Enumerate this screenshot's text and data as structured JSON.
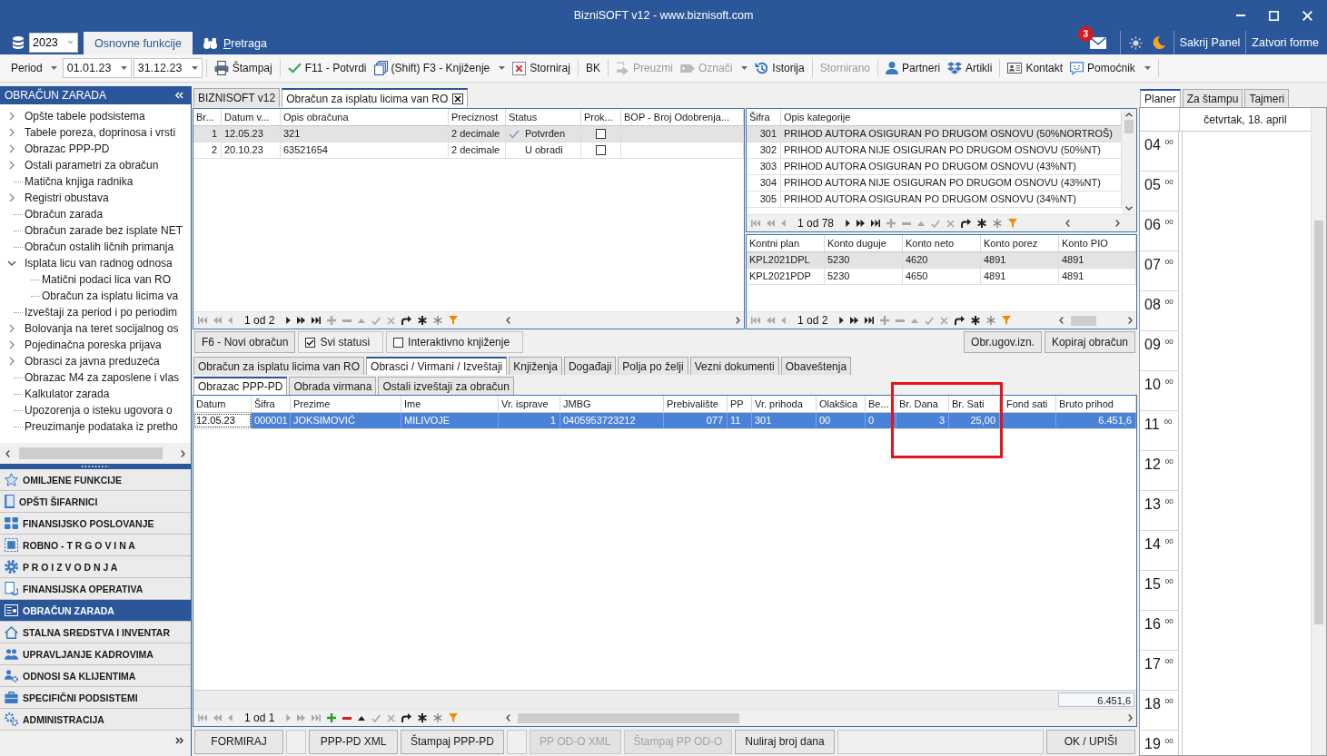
{
  "window": {
    "title": "BizniSOFT v12 - www.biznisoft.com"
  },
  "ribbon": {
    "year": "2023",
    "tabs": [
      {
        "label": "Osnovne funkcije",
        "selected": true,
        "accelerator": false
      },
      {
        "label": "Pretraga",
        "selected": false,
        "accelerator": true
      }
    ],
    "unread": "3",
    "links": [
      "Sakrij Panel",
      "Zatvori forme"
    ]
  },
  "toolbar": {
    "period": {
      "label": "Period",
      "from": "01.01.23",
      "to": "31.12.23"
    },
    "groups": [
      [
        {
          "label": "Štampaj",
          "disabled": false,
          "dropdown": false
        }
      ],
      [
        {
          "label": "F11 - Potvrdi",
          "disabled": false,
          "dropdown": false
        },
        {
          "label": "(Shift) F3 - Knjiženje",
          "disabled": false,
          "dropdown": true
        },
        {
          "label": "Storniraj",
          "disabled": false,
          "dropdown": false
        }
      ],
      [
        {
          "label": "BK",
          "disabled": false,
          "dropdown": false
        }
      ],
      [
        {
          "label": "Preuzmi",
          "disabled": true,
          "dropdown": false
        },
        {
          "label": "Označi",
          "disabled": true,
          "dropdown": true
        },
        {
          "label": "Istorija",
          "disabled": false,
          "dropdown": false
        }
      ],
      [
        {
          "label": "Stornirano",
          "disabled": true,
          "dropdown": false
        }
      ],
      [
        {
          "label": "Partneri",
          "disabled": false,
          "dropdown": false
        },
        {
          "label": "Artikli",
          "disabled": false,
          "dropdown": false
        }
      ],
      [
        {
          "label": "Kontakt",
          "disabled": false,
          "dropdown": false
        },
        {
          "label": "Pomoćnik",
          "disabled": false,
          "dropdown": true
        }
      ]
    ]
  },
  "sidebar": {
    "title": "OBRAČUN ZARADA",
    "tree": [
      {
        "label": "Opšte tabele podsistema",
        "kind": "group",
        "expanded": false
      },
      {
        "label": "Tabele poreza, doprinosa i vrsti",
        "kind": "group",
        "expanded": false
      },
      {
        "label": "Obrazac PPP-PD",
        "kind": "group",
        "expanded": false
      },
      {
        "label": "Ostali parametri za obračun",
        "kind": "group",
        "expanded": false
      },
      {
        "label": "Matična knjiga radnika",
        "kind": "item"
      },
      {
        "label": "Registri obustava",
        "kind": "group",
        "expanded": false
      },
      {
        "label": "Obračun zarada",
        "kind": "item"
      },
      {
        "label": "Obračun zarade bez isplate NET",
        "kind": "item"
      },
      {
        "label": "Obračun ostalih ličnih primanja",
        "kind": "item"
      },
      {
        "label": "Isplata licu van radnog odnosa",
        "kind": "group",
        "expanded": true,
        "children": [
          {
            "label": "Matični podaci lica van RO",
            "kind": "item"
          },
          {
            "label": "Obračun za isplatu licima va",
            "kind": "item"
          }
        ]
      },
      {
        "label": "Izveštaji za period i po periodim",
        "kind": "item"
      },
      {
        "label": "Bolovanja na teret socijalnog os",
        "kind": "group",
        "expanded": false
      },
      {
        "label": "Pojedinačna poreska prijava",
        "kind": "group",
        "expanded": false
      },
      {
        "label": "Obrasci za javna preduzeća",
        "kind": "group",
        "expanded": false
      },
      {
        "label": "Obrazac M4 za zaposlene i vlas",
        "kind": "item"
      },
      {
        "label": "Kalkulator zarada",
        "kind": "item"
      },
      {
        "label": "Upozorenja o isteku ugovora o",
        "kind": "item"
      },
      {
        "label": "Preuzimanje podataka iz pretho",
        "kind": "item"
      }
    ],
    "modules": [
      {
        "label": "OMILJENE FUNKCIJE",
        "selected": false
      },
      {
        "label": "OPŠTI ŠIFARNICI",
        "selected": false
      },
      {
        "label": "FINANSIJSKO POSLOVANJE",
        "selected": false
      },
      {
        "label": "ROBNO - T R G O V I N A",
        "selected": false
      },
      {
        "label": "P R O I Z V O D N J A",
        "selected": false
      },
      {
        "label": "FINANSIJSKA OPERATIVA",
        "selected": false
      },
      {
        "label": "OBRAČUN ZARADA",
        "selected": true
      },
      {
        "label": "STALNA SREDSTVA I INVENTAR",
        "selected": false
      },
      {
        "label": "UPRAVLJANJE KADROVIMA",
        "selected": false
      },
      {
        "label": "ODNOSI SA KLIJENTIMA",
        "selected": false
      },
      {
        "label": "SPECIFIČNI PODSISTEMI",
        "selected": false
      },
      {
        "label": "ADMINISTRACIJA",
        "selected": false
      }
    ]
  },
  "document_tabs": [
    {
      "label": "BIZNISOFT v12",
      "selected": false,
      "closable": false
    },
    {
      "label": "Obračun za isplatu licima van RO",
      "selected": true,
      "closable": true
    }
  ],
  "obracuni": {
    "columns": [
      "Br...",
      "Datum v...",
      "Opis obračuna",
      "Preciznost",
      "Status",
      "Prok...",
      "BOP - Broj Odobrenja..."
    ],
    "rows": [
      {
        "br": "1",
        "datum": "12.05.23",
        "opis": "321",
        "preciznost": "2 decimale",
        "status": "Potvrđen",
        "confirmed": true,
        "prok": false,
        "selected": true
      },
      {
        "br": "2",
        "datum": "20.10.23",
        "opis": "63521654",
        "preciznost": "2 decimale",
        "status": "U obradi",
        "confirmed": false,
        "prok": false,
        "selected": false
      }
    ],
    "navigator": {
      "position": "1 od 2",
      "next_enabled": true,
      "editable": false
    }
  },
  "kategorije": {
    "columns": [
      "Šifra",
      "Opis kategorije"
    ],
    "rows": [
      {
        "sifra": "301",
        "opis": "PRIHOD AUTORA OSIGURAN PO DRUGOM OSNOVU (50%NORTROŠ)",
        "selected": true
      },
      {
        "sifra": "302",
        "opis": "PRIHOD AUTORA NIJE OSIGURAN PO DRUGOM OSNOVU (50%NT)",
        "selected": false
      },
      {
        "sifra": "303",
        "opis": "PRIHOD AUTORA OSIGURAN PO DRUGOM OSNOVU (43%NT)",
        "selected": false
      },
      {
        "sifra": "304",
        "opis": "PRIHOD AUTORA NIJE OSIGURAN PO DRUGOM OSNOVU (43%NT)",
        "selected": false
      },
      {
        "sifra": "305",
        "opis": "PRIHOD AUTORA OSIGURAN PO DRUGOM OSNOVU (34%NT)",
        "selected": false
      }
    ],
    "navigator": {
      "position": "1 od 78",
      "next_enabled": true,
      "editable": false
    }
  },
  "konta": {
    "columns": [
      "Kontni plan",
      "Konto duguje",
      "Konto neto",
      "Konto porez",
      "Konto PIO"
    ],
    "rows": [
      {
        "cells": [
          "KPL2021DPL",
          "5230",
          "4620",
          "4891",
          "4891"
        ],
        "selected": true
      },
      {
        "cells": [
          "KPL2021PDP",
          "5230",
          "4650",
          "4891",
          "4891"
        ],
        "selected": false
      }
    ],
    "navigator": {
      "position": "1 od 2",
      "next_enabled": true,
      "editable": false
    }
  },
  "actions": {
    "left": [
      {
        "kind": "button",
        "label": "F6 - Novi obračun"
      },
      {
        "kind": "checkbox",
        "label": "Svi statusi",
        "checked": true
      },
      {
        "kind": "checkbox",
        "label": "Interaktivno knjiženje",
        "checked": false
      }
    ],
    "right": [
      "Obr.ugov.izn.",
      "Kopiraj obračun"
    ]
  },
  "tabs": [
    {
      "label": "Obračun za isplatu licima van RO",
      "selected": false
    },
    {
      "label": "Obrasci / Virmani / Izveštaji",
      "selected": true
    },
    {
      "label": "Knjiženja",
      "selected": false
    },
    {
      "label": "Događaji",
      "selected": false
    },
    {
      "label": "Polja po želji",
      "selected": false
    },
    {
      "label": "Vezni dokumenti",
      "selected": false
    },
    {
      "label": "Obaveštenja",
      "selected": false
    }
  ],
  "subtabs": [
    {
      "label": "Obrazac PPP-PD",
      "selected": true
    },
    {
      "label": "Obrada virmana",
      "selected": false
    },
    {
      "label": "Ostali izveštaji za obračun",
      "selected": false
    }
  ],
  "ppp": {
    "columns": [
      {
        "label": "Datum",
        "highlighted": false
      },
      {
        "label": "Šifra",
        "highlighted": false
      },
      {
        "label": "Prezime",
        "highlighted": false
      },
      {
        "label": "Ime",
        "highlighted": false
      },
      {
        "label": "Vr. isprave",
        "highlighted": false
      },
      {
        "label": "JMBG",
        "highlighted": false
      },
      {
        "label": "Prebivalište",
        "highlighted": false
      },
      {
        "label": "PP",
        "highlighted": false
      },
      {
        "label": "Vr. prihoda",
        "highlighted": false
      },
      {
        "label": "Olakšica",
        "highlighted": false
      },
      {
        "label": "Be...",
        "highlighted": false
      },
      {
        "label": "Br. Dana",
        "highlighted": true
      },
      {
        "label": "Br. Sati",
        "highlighted": true
      },
      {
        "label": "Fond sati",
        "highlighted": false
      },
      {
        "label": "Bruto prihod",
        "highlighted": false
      }
    ],
    "rows": [
      {
        "selected": true,
        "cells": [
          {
            "text": "12.05.23",
            "focused": true
          },
          {
            "text": "000001",
            "focused": false
          },
          {
            "text": "JOKSIMOVIĆ",
            "focused": false
          },
          {
            "text": "MILIVOJE",
            "focused": false
          },
          {
            "text": "1",
            "focused": false
          },
          {
            "text": "0405953723212",
            "focused": false
          },
          {
            "text": "077",
            "focused": false
          },
          {
            "text": "11",
            "focused": false
          },
          {
            "text": "301",
            "focused": false
          },
          {
            "text": "00",
            "focused": false
          },
          {
            "text": "0",
            "focused": false
          },
          {
            "text": "3",
            "focused": false
          },
          {
            "text": "25,00",
            "focused": false
          },
          {
            "focused": false
          },
          {
            "text": "6.451,6",
            "focused": false
          }
        ]
      }
    ],
    "total": "6.451,6",
    "navigator": {
      "position": "1 od 1",
      "next_enabled": false,
      "editable": true
    }
  },
  "footer_buttons": [
    {
      "kind": "button",
      "label": "FORMIRAJ",
      "disabled": false
    },
    {
      "kind": "spacer"
    },
    {
      "kind": "button",
      "label": "PPP-PD XML",
      "disabled": false
    },
    {
      "kind": "button",
      "label": "Štampaj PPP-PD",
      "disabled": false
    },
    {
      "kind": "spacer"
    },
    {
      "kind": "button",
      "label": "PP OD-O XML",
      "disabled": true
    },
    {
      "kind": "button",
      "label": "Štampaj PP OD-O",
      "disabled": true
    },
    {
      "kind": "button",
      "label": "Nuliraj broj dana",
      "disabled": false
    },
    {
      "kind": "spacer"
    },
    {
      "kind": "button",
      "label": "OK / UPIŠI",
      "disabled": false
    }
  ],
  "planner": {
    "tabs": [
      {
        "label": "Planer",
        "selected": true
      },
      {
        "label": "Za štampu",
        "selected": false
      },
      {
        "label": "Tajmeri",
        "selected": false
      }
    ],
    "day": "četvrtak, 18. april",
    "hours": [
      {
        "hour": "04",
        "minutes": "00"
      },
      {
        "hour": "05",
        "minutes": "00"
      },
      {
        "hour": "06",
        "minutes": "00"
      },
      {
        "hour": "07",
        "minutes": "00"
      },
      {
        "hour": "08",
        "minutes": "00"
      },
      {
        "hour": "09",
        "minutes": "00"
      },
      {
        "hour": "10",
        "minutes": "00"
      },
      {
        "hour": "11",
        "minutes": "00"
      },
      {
        "hour": "12",
        "minutes": "00"
      },
      {
        "hour": "13",
        "minutes": "00"
      },
      {
        "hour": "14",
        "minutes": "00"
      },
      {
        "hour": "15",
        "minutes": "00"
      },
      {
        "hour": "16",
        "minutes": "00"
      },
      {
        "hour": "17",
        "minutes": "00"
      },
      {
        "hour": "18",
        "minutes": "00"
      },
      {
        "hour": "19",
        "minutes": "00"
      }
    ]
  }
}
